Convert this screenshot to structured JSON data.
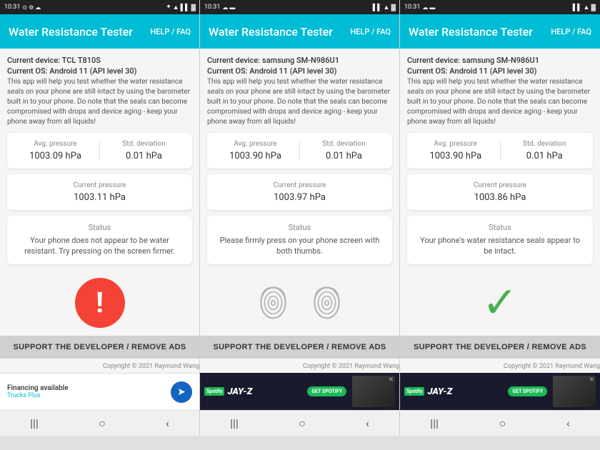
{
  "statusBars": [
    {
      "time": "10:31",
      "icons_left": [
        "notification-dot"
      ],
      "icons_right": [
        "bluetooth",
        "wifi",
        "signal",
        "battery"
      ]
    },
    {
      "time": "10:31",
      "icons_left": [],
      "icons_right": [
        "signal",
        "wifi",
        "battery"
      ]
    },
    {
      "time": "10:31",
      "icons_left": [],
      "icons_right": [
        "signal",
        "wifi",
        "battery"
      ]
    }
  ],
  "phones": [
    {
      "id": "phone1",
      "header": {
        "title": "Water Resistance Tester",
        "help_label": "HELP / FAQ"
      },
      "device": "Current device: TCL T810S",
      "os": "Current OS: Android 11 (API level 30)",
      "description": "This app will help you test whether the water resistance seals on your phone are still intact by using the barometer built in to your phone. Do note that the seals can become compromised with drops and device aging - keep your phone away from all liquids!",
      "avg_pressure_label": "Avg. pressure",
      "avg_pressure_value": "1003.09 hPa",
      "std_dev_label": "Std. deviation",
      "std_dev_value": "0.01 hPa",
      "current_pressure_label": "Current pressure",
      "current_pressure_value": "1003.11 hPa",
      "status_label": "Status",
      "status_text": "Your phone does not appear to be water resistant. Try pressing on the screen firmer.",
      "indicator": "error",
      "support_btn": "SUPPORT THE DEVELOPER / REMOVE ADS",
      "copyright": "Copyright © 2021 Raymond Wang",
      "financing_title": "Financing available",
      "financing_sub": "Trucks Plus"
    },
    {
      "id": "phone2",
      "header": {
        "title": "Water Resistance Tester",
        "help_label": "HELP / FAQ"
      },
      "device": "Current device: samsung SM-N986U1",
      "os": "Current OS: Android 11 (API level 30)",
      "description": "This app will help you test whether the water resistance seals on your phone are still intact by using the barometer built in to your phone. Do note that the seals can become compromised with drops and device aging - keep your phone away from all liquids!",
      "avg_pressure_label": "Avg. pressure",
      "avg_pressure_value": "1003.90 hPa",
      "std_dev_label": "Std. deviation",
      "std_dev_value": "0.01 hPa",
      "current_pressure_label": "Current pressure",
      "current_pressure_value": "1003.97 hPa",
      "status_label": "Status",
      "status_text": "Please firmly press on your phone screen with both thumbs.",
      "indicator": "fingerprints",
      "support_btn": "SUPPORT THE DEVELOPER / REMOVE ADS",
      "copyright": "Copyright © 2021 Raymond Wang",
      "ad_artist": "JAY-Z",
      "ad_get": "GET SPOTIFY",
      "ad_spotify": "Spotify"
    },
    {
      "id": "phone3",
      "header": {
        "title": "Water Resistance Tester",
        "help_label": "HELP / FAQ"
      },
      "device": "Current device: samsung SM-N986U1",
      "os": "Current OS: Android 11 (API level 30)",
      "description": "This app will help you test whether the water resistance seals on your phone are still intact by using the barometer built in to your phone. Do note that the seals can become compromised with drops and device aging - keep your phone away from all liquids!",
      "avg_pressure_label": "Avg. pressure",
      "avg_pressure_value": "1003.90 hPa",
      "std_dev_label": "Std. deviation",
      "std_dev_value": "0.01 hPa",
      "current_pressure_label": "Current pressure",
      "current_pressure_value": "1003.86 hPa",
      "status_label": "Status",
      "status_text": "Your phone's water resistance seals appear to be intact.",
      "indicator": "check",
      "support_btn": "SUPPORT THE DEVELOPER / REMOVE ADS",
      "copyright": "Copyright © 2021 Raymond Wang",
      "ad_artist": "JAY-Z",
      "ad_get": "GET SPOTIFY",
      "ad_spotify": "Spotify"
    }
  ]
}
